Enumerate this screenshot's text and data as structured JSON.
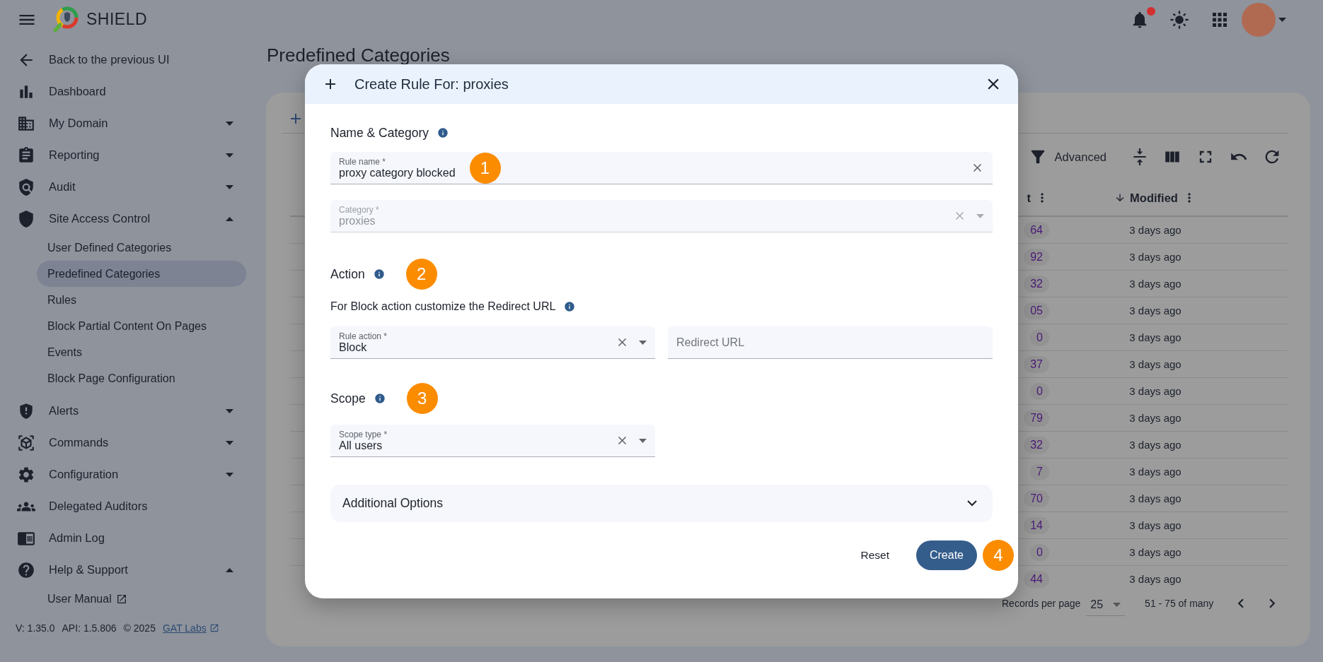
{
  "topbar": {
    "app_name": "SHIELD",
    "notification_dot": true
  },
  "sidebar": {
    "items": [
      {
        "kind": "link",
        "label": "Back to the previous UI"
      },
      {
        "kind": "link",
        "label": "Dashboard"
      },
      {
        "kind": "group",
        "label": "My Domain",
        "expanded": false
      },
      {
        "kind": "group",
        "label": "Reporting",
        "expanded": false
      },
      {
        "kind": "group",
        "label": "Audit",
        "expanded": false
      },
      {
        "kind": "group",
        "label": "Site Access Control",
        "expanded": true,
        "children": [
          {
            "label": "User Defined Categories",
            "selected": false
          },
          {
            "label": "Predefined Categories",
            "selected": true
          },
          {
            "label": "Rules",
            "selected": false
          },
          {
            "label": "Block Partial Content On Pages",
            "selected": false
          },
          {
            "label": "Events",
            "selected": false
          },
          {
            "label": "Block Page Configuration",
            "selected": false
          }
        ]
      },
      {
        "kind": "group",
        "label": "Alerts",
        "expanded": false
      },
      {
        "kind": "group",
        "label": "Commands",
        "expanded": false
      },
      {
        "kind": "group",
        "label": "Configuration",
        "expanded": false
      },
      {
        "kind": "link",
        "label": "Delegated Auditors"
      },
      {
        "kind": "link",
        "label": "Admin Log"
      },
      {
        "kind": "group",
        "label": "Help & Support",
        "expanded": true,
        "children": [
          {
            "label": "User Manual",
            "selected": false,
            "external": true
          }
        ]
      }
    ],
    "footer": {
      "version": "V: 1.35.0",
      "api": "API: 1.5.806",
      "copyright": "© 2025",
      "link": "GAT Labs"
    }
  },
  "page": {
    "title": "Predefined Categories",
    "toolbar": {
      "advanced_label": "Advanced"
    },
    "table": {
      "columns": [
        {
          "label": "t",
          "sorted": false
        },
        {
          "label": "Modified",
          "sorted": true
        }
      ],
      "rows": [
        {
          "count": "64",
          "modified": "3 days ago"
        },
        {
          "count": "92",
          "modified": "3 days ago"
        },
        {
          "count": "32",
          "modified": "3 days ago"
        },
        {
          "count": "05",
          "modified": "3 days ago"
        },
        {
          "count": "0",
          "modified": "3 days ago"
        },
        {
          "count": "37",
          "modified": "3 days ago"
        },
        {
          "count": "0",
          "modified": "3 days ago"
        },
        {
          "count": "79",
          "modified": "3 days ago"
        },
        {
          "count": "32",
          "modified": "3 days ago"
        },
        {
          "count": "7",
          "modified": "3 days ago"
        },
        {
          "count": "70",
          "modified": "3 days ago"
        },
        {
          "count": "14",
          "modified": "3 days ago"
        },
        {
          "count": "0",
          "modified": "3 days ago"
        },
        {
          "count": "44",
          "modified": "3 days ago"
        }
      ]
    },
    "pagination": {
      "label": "Records per page",
      "page_size": "25",
      "range": "51 - 75 of many"
    }
  },
  "dialog": {
    "title": "Create Rule For: proxies",
    "sections": [
      {
        "kind": "stacked",
        "heading": "Name & Category",
        "fields": [
          {
            "kind": "text",
            "label": "Rule name *",
            "value": "proxy category blocked",
            "disabled": false,
            "marker": "1"
          },
          {
            "kind": "select",
            "label": "Category *",
            "value": "proxies",
            "disabled": true
          }
        ]
      },
      {
        "kind": "inline",
        "heading": "Action",
        "marker": "2",
        "note": "For Block action customize the Redirect URL",
        "fields": [
          {
            "kind": "select",
            "label": "Rule action *",
            "value": "Block",
            "disabled": false
          },
          {
            "kind": "text",
            "placeholder": "Redirect URL",
            "disabled": false
          }
        ]
      },
      {
        "kind": "inline",
        "heading": "Scope",
        "marker": "3",
        "fields": [
          {
            "kind": "select",
            "label": "Scope type *",
            "value": "All users",
            "disabled": false
          }
        ]
      }
    ],
    "accordion": {
      "label": "Additional Options",
      "expanded": false
    },
    "buttons": {
      "reset": "Reset",
      "create": "Create",
      "create_marker": "4"
    }
  }
}
